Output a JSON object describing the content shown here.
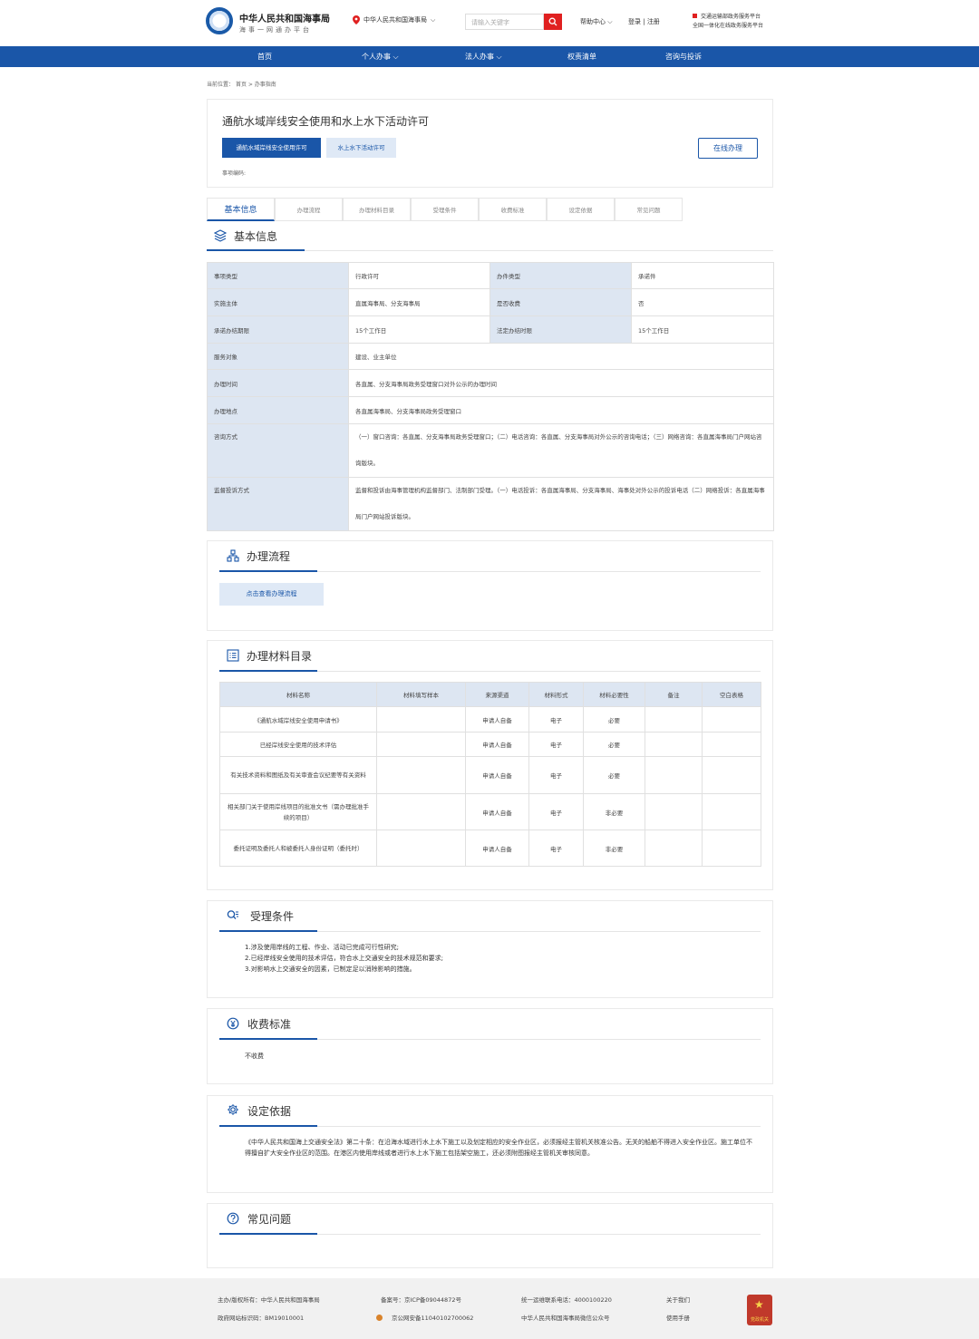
{
  "header": {
    "org_name": "中华人民共和国海事局",
    "org_sub": "海事一网通办平台",
    "location": "中华人民共和国海事局",
    "search_placeholder": "请输入关键字",
    "help": "帮助中心",
    "login": "登录",
    "register": "注册",
    "platform_line1": "交通运输部政务服务平台",
    "platform_line2": "全国一体化在线政务服务平台"
  },
  "nav": [
    "首页",
    "个人办事",
    "法人办事",
    "权责清单",
    "咨询与投诉"
  ],
  "breadcrumb": {
    "label": "当前位置：",
    "home": "首页",
    "current": "办事指南"
  },
  "item": {
    "title": "通航水域岸线安全使用和水上水下活动许可",
    "tab1": "通航水域岸线安全使用许可",
    "tab2": "水上水下活动许可",
    "online_button": "在线办理",
    "code_label": "事项编码:"
  },
  "tabs": [
    "基本信息",
    "办理流程",
    "办理材料目录",
    "受理条件",
    "收费标准",
    "设定依据",
    "常见问题"
  ],
  "basic": {
    "title": "基本信息",
    "rows": [
      [
        "事项类型",
        "行政许可",
        "办件类型",
        "承诺件"
      ],
      [
        "实施主体",
        "直属海事局、分支海事局",
        "是否收费",
        "否"
      ],
      [
        "承诺办结期限",
        "15个工作日",
        "法定办结时限",
        "15个工作日"
      ]
    ],
    "wide_rows": [
      [
        "服务对象",
        "建设、业主单位"
      ],
      [
        "办理时间",
        "各直属、分支海事局政务受理窗口对外公示的办理时间"
      ],
      [
        "办理地点",
        "各直属海事局、分支海事局政务受理窗口"
      ],
      [
        "咨询方式",
        "（一）窗口咨询：各直属、分支海事局政务受理窗口；（二）电话咨询：各直属、分支海事局对外公示的咨询电话；（三）网络咨询：各直属海事局门户网站咨询版块。"
      ],
      [
        "监督投诉方式",
        "监督和投诉由海事管理机构监督部门、法制部门受理。（一）电话投诉：各直属海事局、分支海事局、海事处对外公示的投诉电话（二）网络投诉：各直属海事局门户网站投诉版块。"
      ]
    ]
  },
  "process": {
    "title": "办理流程",
    "button": "点击查看办理流程"
  },
  "materials": {
    "title": "办理材料目录",
    "headers": [
      "材料名称",
      "材料填写样本",
      "来源渠道",
      "材料形式",
      "材料必要性",
      "备注",
      "空白表格"
    ],
    "rows": [
      [
        "《通航水域岸线安全使用申请书》",
        "",
        "申请人自备",
        "电子",
        "必要",
        "",
        ""
      ],
      [
        "已经岸线安全使用的技术评估",
        "",
        "申请人自备",
        "电子",
        "必要",
        "",
        ""
      ],
      [
        "有关技术资料和图纸及有关审查会议纪要等有关资料",
        "",
        "申请人自备",
        "电子",
        "必要",
        "",
        ""
      ],
      [
        "相关部门关于使用岸线项目的批准文书（需办理批准手续的项目）",
        "",
        "申请人自备",
        "电子",
        "非必要",
        "",
        ""
      ],
      [
        "委托证明及委托人和被委托人身份证明（委托时）",
        "",
        "申请人自备",
        "电子",
        "非必要",
        "",
        ""
      ]
    ]
  },
  "conditions": {
    "title": "受理条件",
    "lines": [
      "1.涉及使用岸线的工程、作业、活动已完成可行性研究;",
      "2.已经岸线安全使用的技术评估，符合水上交通安全的技术规范和要求;",
      "3.对影响水上交通安全的因素，已制定足以消除影响的措施。"
    ]
  },
  "fees": {
    "title": "收费标准",
    "text": "不收费"
  },
  "basis": {
    "title": "设定依据",
    "text": "《中华人民共和国海上交通安全法》第二十条：在沿海水域进行水上水下施工以及划定相应的安全作业区，必须报经主管机关核准公告。无关的船舶不得进入安全作业区。施工单位不得擅自扩大安全作业区的范围。在港区内使用岸线或者进行水上水下施工包括架空施工，还必须附图报经主管机关审核同意。"
  },
  "faq": {
    "title": "常见问题"
  },
  "footer": {
    "sponsor": "主办/版权所有：中华人民共和国海事局",
    "site_code": "政府网站标识码：BM19010001",
    "icp": "备案号：京ICP备09044872号",
    "police": "京公网安备11040102700062",
    "hotline": "统一运维联系电话：4000100220",
    "wechat": "中华人民共和国海事局微信公众号",
    "about": "关于我们",
    "manual": "使用手册",
    "badge": "党政机关"
  },
  "colors": {
    "primary": "#1a56a8",
    "search": "#e02020",
    "key_cell": "#dde6f2"
  }
}
